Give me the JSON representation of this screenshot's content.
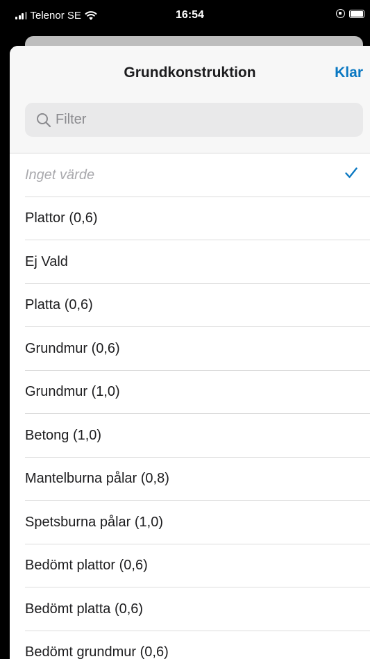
{
  "status_bar": {
    "carrier": "Telenor SE",
    "time": "16:54"
  },
  "sheet": {
    "title": "Grundkonstruktion",
    "done_label": "Klar",
    "filter_placeholder": "Filter",
    "filter_value": ""
  },
  "options": [
    {
      "label": "Inget värde",
      "selected": true,
      "muted": true
    },
    {
      "label": "Plattor (0,6)"
    },
    {
      "label": "Ej Vald"
    },
    {
      "label": "Platta (0,6)"
    },
    {
      "label": "Grundmur (0,6)"
    },
    {
      "label": "Grundmur (1,0)"
    },
    {
      "label": "Betong (1,0)"
    },
    {
      "label": "Mantelburna pålar (0,8)"
    },
    {
      "label": "Spetsburna pålar (1,0)"
    },
    {
      "label": "Bedömt plattor (0,6)"
    },
    {
      "label": "Bedömt platta (0,6)"
    },
    {
      "label": "Bedömt grundmur (0,6)"
    }
  ],
  "colors": {
    "accent": "#0a78c2",
    "checkmark": "#0a78c2"
  }
}
